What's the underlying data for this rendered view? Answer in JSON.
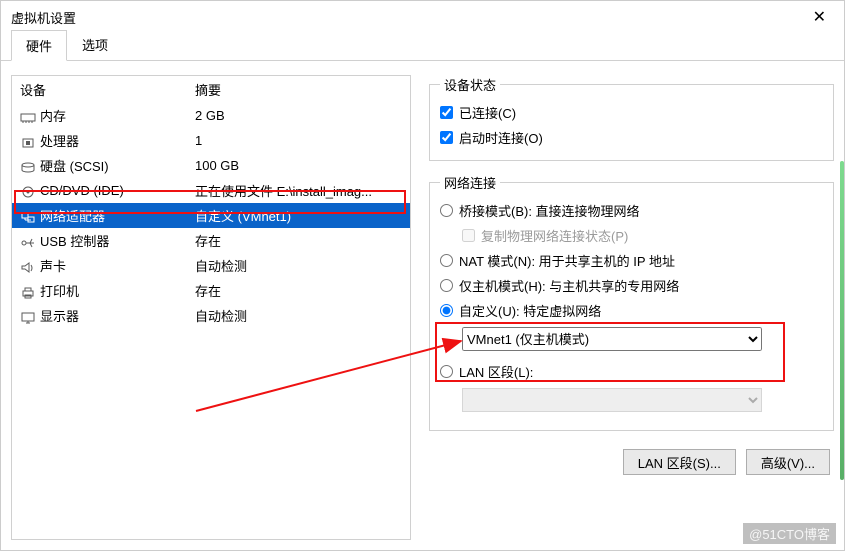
{
  "window": {
    "title": "虚拟机设置"
  },
  "tabs": {
    "hardware": "硬件",
    "options": "选项"
  },
  "device_table": {
    "headers": {
      "device": "设备",
      "summary": "摘要"
    },
    "rows": [
      {
        "icon": "memory-icon",
        "name": "内存",
        "summary": "2 GB"
      },
      {
        "icon": "cpu-icon",
        "name": "处理器",
        "summary": "1"
      },
      {
        "icon": "disk-icon",
        "name": "硬盘 (SCSI)",
        "summary": "100 GB"
      },
      {
        "icon": "cd-icon",
        "name": "CD/DVD (IDE)",
        "summary": "正在使用文件 E:\\install_imag..."
      },
      {
        "icon": "nic-icon",
        "name": "网络适配器",
        "summary": "自定义 (VMnet1)"
      },
      {
        "icon": "usb-icon",
        "name": "USB 控制器",
        "summary": "存在"
      },
      {
        "icon": "sound-icon",
        "name": "声卡",
        "summary": "自动检测"
      },
      {
        "icon": "printer-icon",
        "name": "打印机",
        "summary": "存在"
      },
      {
        "icon": "display-icon",
        "name": "显示器",
        "summary": "自动检测"
      }
    ],
    "selected_index": 4
  },
  "device_status": {
    "legend": "设备状态",
    "connected": "已连接(C)",
    "connect_at_power_on": "启动时连接(O)"
  },
  "network": {
    "legend": "网络连接",
    "bridge": "桥接模式(B): 直接连接物理网络",
    "bridge_replicate": "复制物理网络连接状态(P)",
    "nat": "NAT 模式(N): 用于共享主机的 IP 地址",
    "hostonly": "仅主机模式(H): 与主机共享的专用网络",
    "custom": "自定义(U): 特定虚拟网络",
    "custom_select": "VMnet1 (仅主机模式)",
    "lan": "LAN 区段(L):",
    "lan_select": ""
  },
  "buttons": {
    "lan_segments": "LAN 区段(S)...",
    "advanced": "高级(V)..."
  },
  "watermark": "@51CTO博客"
}
